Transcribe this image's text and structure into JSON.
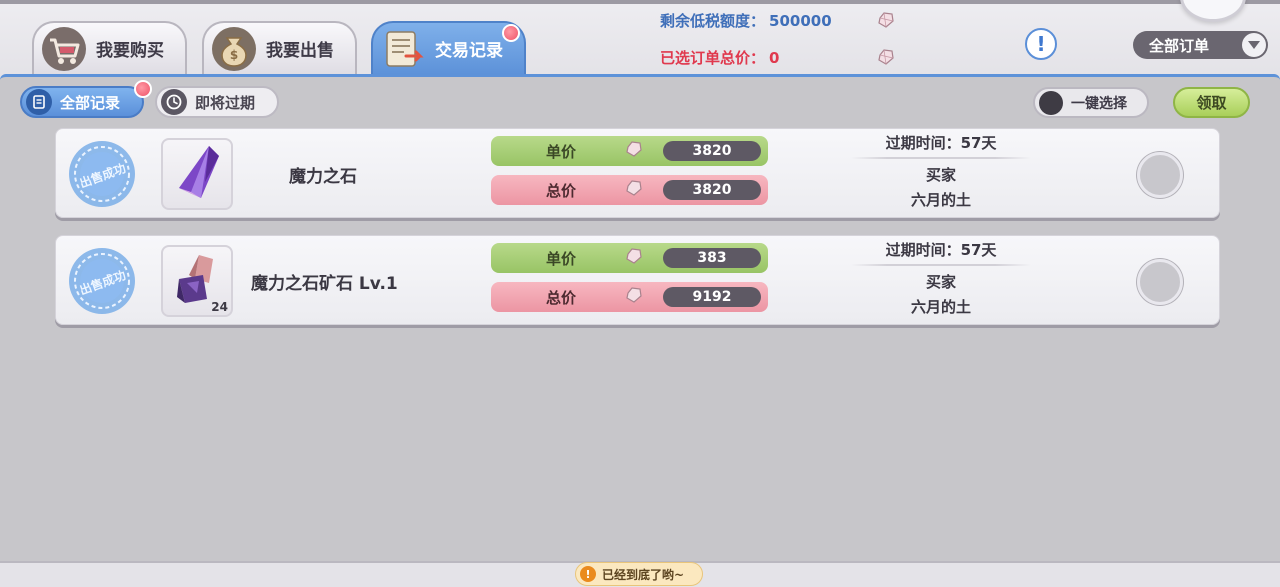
{
  "tabs": [
    {
      "label": "我要购买",
      "icon": "shopping-cart-icon"
    },
    {
      "label": "我要出售",
      "icon": "money-bag-icon"
    },
    {
      "label": "交易记录",
      "icon": "scroll-icon"
    }
  ],
  "header": {
    "tax_label": "剩余低税额度：",
    "tax_value": "500000",
    "total_label": "已选订单总价：",
    "total_value": "0",
    "tax_color": "#3f6fb9",
    "total_color": "#e0394e"
  },
  "filter": {
    "selected": "全部订单"
  },
  "subtabs": [
    {
      "label": "全部记录",
      "icon": "document-icon"
    },
    {
      "label": "即将过期",
      "icon": "clock-icon"
    }
  ],
  "actions": {
    "select_all": "一键选择",
    "claim": "领取"
  },
  "records": [
    {
      "stamp": "出售成功",
      "item_name": "魔力之石",
      "item_icon": "magic-crystal-icon",
      "item_qty": "",
      "unit_label": "单价",
      "unit_price": "3820",
      "total_label": "总价",
      "total_price": "3820",
      "expire": "过期时间：57天",
      "buyer_label": "买家",
      "buyer": "六月的土"
    },
    {
      "stamp": "出售成功",
      "item_name": "魔力之石矿石 Lv.1",
      "item_icon": "crystal-ore-icon",
      "item_qty": "24",
      "unit_label": "单价",
      "unit_price": "383",
      "total_label": "总价",
      "total_price": "9192",
      "expire": "过期时间：57天",
      "buyer_label": "买家",
      "buyer": "六月的土"
    }
  ],
  "footer": {
    "toast": "已经到底了哟~"
  },
  "colors": {
    "accent": "#5d92d9",
    "unit_bar": "#a9cf76",
    "total_bar": "#f0a3b0",
    "claim": "#a9cf5a"
  }
}
